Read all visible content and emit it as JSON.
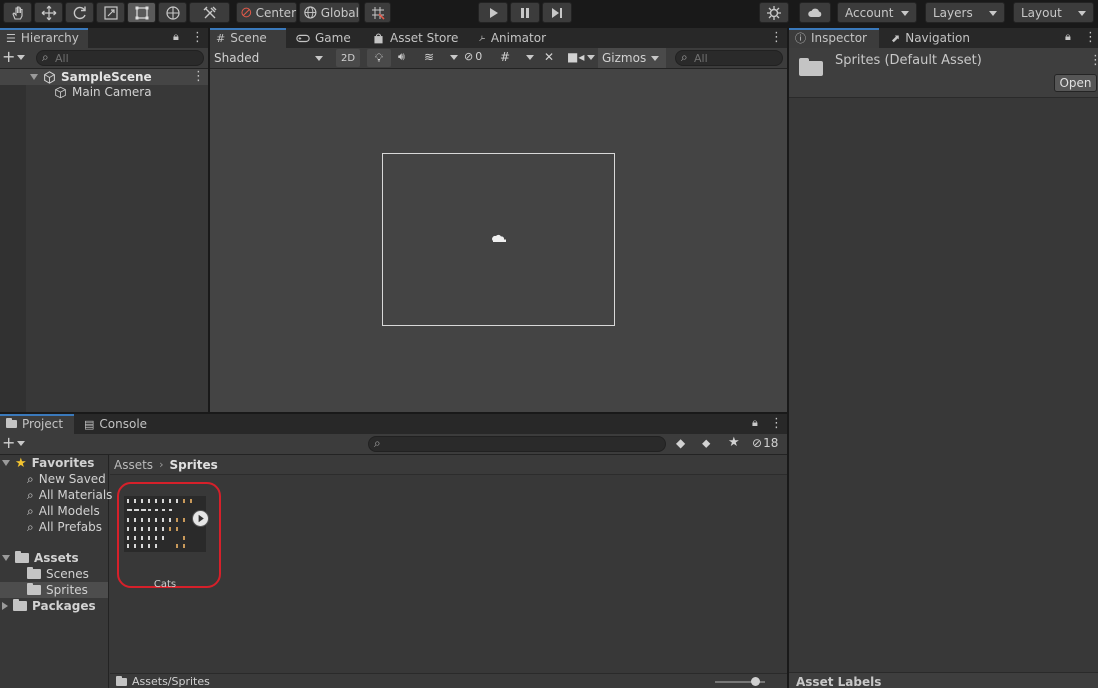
{
  "toolbar": {
    "center_label": "Center",
    "global_label": "Global",
    "account_label": "Account",
    "layers_label": "Layers",
    "layout_label": "Layout"
  },
  "hierarchy": {
    "tab_label": "Hierarchy",
    "search_placeholder": "All",
    "scene_name": "SampleScene",
    "items": [
      {
        "label": "Main Camera"
      }
    ]
  },
  "scene_view": {
    "tabs": [
      {
        "label": "Scene"
      },
      {
        "label": "Game"
      },
      {
        "label": "Asset Store"
      },
      {
        "label": "Animator"
      }
    ],
    "shading_mode": "Shaded",
    "mode_2d_label": "2D",
    "hidden_count": "0",
    "gizmos_label": "Gizmos",
    "search_placeholder": "All"
  },
  "inspector": {
    "tabs": [
      {
        "label": "Inspector"
      },
      {
        "label": "Navigation"
      }
    ],
    "asset_title": "Sprites (Default Asset)",
    "open_button": "Open",
    "asset_labels": "Asset Labels"
  },
  "project": {
    "tabs": [
      {
        "label": "Project"
      },
      {
        "label": "Console"
      }
    ],
    "hidden_count": "18",
    "favorites_label": "Favorites",
    "favorites": [
      {
        "label": "New Saved"
      },
      {
        "label": "All Materials"
      },
      {
        "label": "All Models"
      },
      {
        "label": "All Prefabs"
      }
    ],
    "assets_label": "Assets",
    "asset_folders": [
      {
        "label": "Scenes"
      },
      {
        "label": "Sprites"
      }
    ],
    "packages_label": "Packages",
    "breadcrumb": [
      {
        "label": "Assets"
      },
      {
        "label": "Sprites"
      }
    ],
    "grid_items": [
      {
        "label": "Cats"
      }
    ],
    "footer_path": "Assets/Sprites"
  },
  "colors": {
    "accent": "#3a79bb",
    "highlight_ring": "#d6202a",
    "favorites_star": "#f4c430"
  }
}
